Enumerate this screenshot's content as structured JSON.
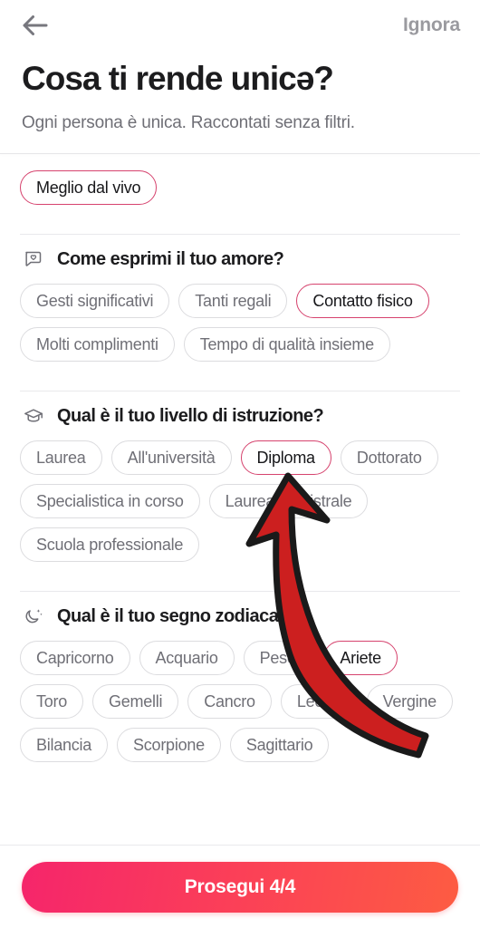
{
  "topbar": {
    "back_icon": "arrow-left-icon",
    "skip_label": "Ignora"
  },
  "header": {
    "title": "Cosa ti rende unicə?",
    "subtitle": "Ogni persona è unica. Raccontati senza filtri."
  },
  "top_chips": [
    {
      "label": "Meglio dal vivo",
      "selected": true
    }
  ],
  "sections": [
    {
      "icon": "chat-heart-icon",
      "title": "Come esprimi il tuo amore?",
      "chips": [
        {
          "label": "Gesti significativi",
          "selected": false
        },
        {
          "label": "Tanti regali",
          "selected": false
        },
        {
          "label": "Contatto fisico",
          "selected": true
        },
        {
          "label": "Molti complimenti",
          "selected": false
        },
        {
          "label": "Tempo di qualità insieme",
          "selected": false
        }
      ]
    },
    {
      "icon": "graduation-cap-icon",
      "title": "Qual è il tuo livello di istruzione?",
      "chips": [
        {
          "label": "Laurea",
          "selected": false
        },
        {
          "label": "All'università",
          "selected": false
        },
        {
          "label": "Diploma",
          "selected": true
        },
        {
          "label": "Dottorato",
          "selected": false
        },
        {
          "label": "Specialistica in corso",
          "selected": false
        },
        {
          "label": "Laurea magistrale",
          "selected": false
        },
        {
          "label": "Scuola professionale",
          "selected": false
        }
      ]
    },
    {
      "icon": "moon-stars-icon",
      "title": "Qual è il tuo segno zodiacale?",
      "chips": [
        {
          "label": "Capricorno",
          "selected": false
        },
        {
          "label": "Acquario",
          "selected": false
        },
        {
          "label": "Pesci",
          "selected": false
        },
        {
          "label": "Ariete",
          "selected": true
        },
        {
          "label": "Toro",
          "selected": false
        },
        {
          "label": "Gemelli",
          "selected": false
        },
        {
          "label": "Cancro",
          "selected": false
        },
        {
          "label": "Leone",
          "selected": false
        },
        {
          "label": "Vergine",
          "selected": false
        },
        {
          "label": "Bilancia",
          "selected": false
        },
        {
          "label": "Scorpione",
          "selected": false
        },
        {
          "label": "Sagittario",
          "selected": false
        }
      ]
    }
  ],
  "footer": {
    "cta_label": "Prosegui 4/4"
  },
  "overlay": {
    "arrow_icon": "curved-up-arrow-annotation",
    "arrow_color": "#cc1f1f",
    "arrow_outline": "#1a1a1a"
  },
  "colors": {
    "selected_border": "#d6436e",
    "chip_border": "#dcdcdf",
    "chip_text": "#6f6f76",
    "title_text": "#1c1c1e",
    "cta_gradient_start": "#f5256b",
    "cta_gradient_end": "#fd5c42"
  }
}
